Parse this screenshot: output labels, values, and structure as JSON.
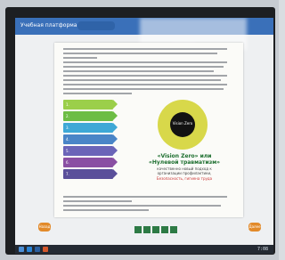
{
  "window": {
    "title": "Учебная платформа",
    "accent": "#3a70b9"
  },
  "diagram": {
    "steps": [
      {
        "label": "1.",
        "color": "#9bcf4a"
      },
      {
        "label": "2.",
        "color": "#6dbd45"
      },
      {
        "label": "3.",
        "color": "#3ea8d6"
      },
      {
        "label": "4.",
        "color": "#4a85c7"
      },
      {
        "label": "5.",
        "color": "#6b64b8"
      },
      {
        "label": "6.",
        "color": "#8a4fa3"
      },
      {
        "label": "7.",
        "color": "#5a4f9a"
      }
    ],
    "center_label": "Vision Zero",
    "headline": "«Vision Zero» или «Нулевой травматизм»",
    "subtitle": "качественно новый подход к организации профилактики,",
    "subtitle_red": "Безопасность, гигиена труда"
  },
  "navigation": {
    "back_label": "Назад",
    "next_label": "Далее"
  },
  "social_icons": [
    "vk-icon",
    "ok-icon",
    "facebook-icon",
    "twitter-icon",
    "youtube-icon"
  ],
  "taskbar": {
    "clock": "7:08"
  }
}
